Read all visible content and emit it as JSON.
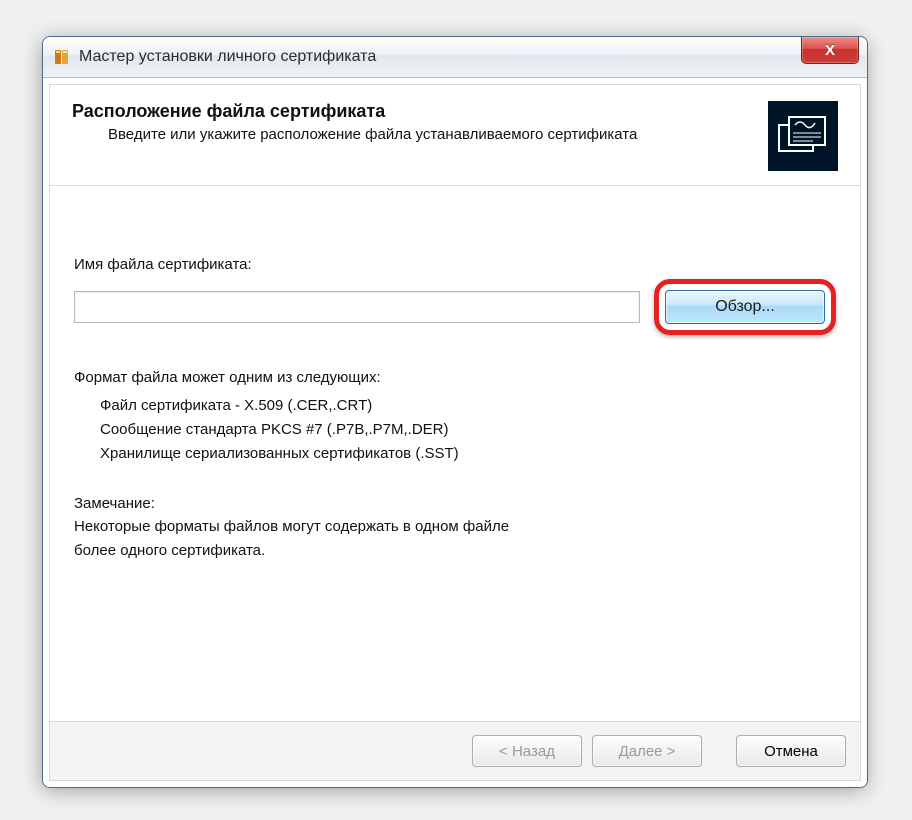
{
  "window": {
    "title": "Мастер установки личного сертификата"
  },
  "header": {
    "title": "Расположение файла сертификата",
    "subtitle": "Введите или укажите расположение файла устанавливаемого сертификата"
  },
  "form": {
    "file_label": "Имя файла сертификата:",
    "file_value": "",
    "browse_label": "Обзор..."
  },
  "formats": {
    "title": "Формат файла может одним из следующих:",
    "items": [
      "Файл сертификата - X.509 (.CER,.CRT)",
      "Сообщение стандарта PKCS #7 (.P7B,.P7M,.DER)",
      "Хранилище сериализованных сертификатов (.SST)"
    ]
  },
  "note": {
    "label": "Замечание:",
    "text1": "Некоторые форматы файлов могут содержать в одном файле",
    "text2": "более одного сертификата."
  },
  "footer": {
    "back": "< Назад",
    "next": "Далее >",
    "cancel": "Отмена"
  }
}
